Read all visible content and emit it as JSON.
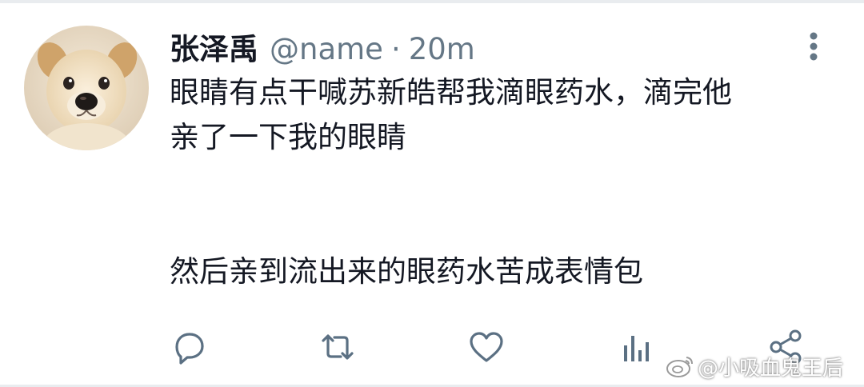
{
  "tweet": {
    "author_name": "张泽禹",
    "handle": "@name",
    "separator": "·",
    "time": "20m",
    "text_line1": "眼睛有点干喊苏新皓帮我滴眼药水，滴完他",
    "text_line2": "亲了一下我的眼睛",
    "text_line3": "然后亲到流出来的眼药水苦成表情包"
  },
  "actions": [
    {
      "icon": "reply-icon"
    },
    {
      "icon": "retweet-icon"
    },
    {
      "icon": "like-icon"
    },
    {
      "icon": "analytics-icon"
    },
    {
      "icon": "share-icon"
    }
  ],
  "watermark": {
    "text": "@小吸血鬼王后",
    "icon": "weibo-logo"
  },
  "colors": {
    "text": "#141823",
    "secondary": "#657786",
    "icon": "#5b7083"
  }
}
